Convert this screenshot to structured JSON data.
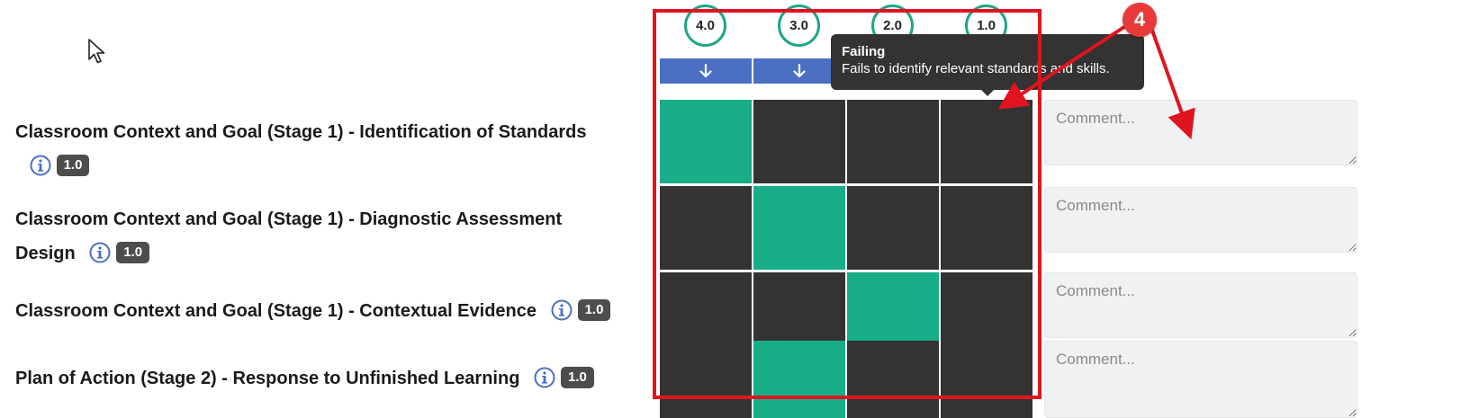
{
  "scale": {
    "levels": [
      {
        "score": "4.0"
      },
      {
        "score": "3.0"
      },
      {
        "score": "2.0"
      },
      {
        "score": "1.0"
      }
    ],
    "header_color": "#1fa588",
    "arrow_color": "#4a6fc3",
    "arrow_icon": "arrow-down-icon"
  },
  "criteria": [
    {
      "title_line1": "Classroom Context and Goal (Stage 1) - Identification of Standards",
      "title_line2": "",
      "weight": "1.0",
      "selected_level": 0
    },
    {
      "title_line1": "Classroom Context and Goal (Stage 1) - Diagnostic Assessment",
      "title_line2": "Design",
      "weight": "1.0",
      "selected_level": 1
    },
    {
      "title_line1": "Classroom Context and Goal (Stage 1) - Contextual Evidence",
      "title_line2": "",
      "weight": "1.0",
      "selected_level": 2
    },
    {
      "title_line1": "Plan of Action (Stage 2) - Response to Unfinished Learning",
      "title_line2": "",
      "weight": "1.0",
      "selected_level": 1
    }
  ],
  "comment": {
    "placeholder": "Comment...",
    "value": ""
  },
  "tooltip": {
    "title": "Failing",
    "text": "Fails to identify relevant standards and skills."
  },
  "annotation": {
    "step_number": "4",
    "color": "#e0141e"
  },
  "colors": {
    "cell_selected": "#17ad87",
    "cell_unselected": "#333333",
    "info_icon": "#4a6fc3",
    "weight_badge": "#4d4d4d"
  }
}
